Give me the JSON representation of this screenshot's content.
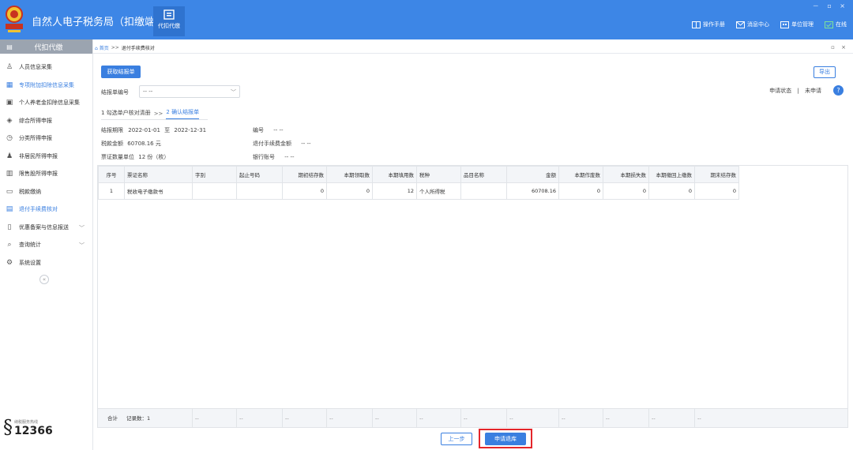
{
  "topbar": {
    "app_title": "自然人电子税务局（扣缴端）",
    "nav_box_label": "代扣代缴",
    "window_controls": "－ ▫ ×",
    "right_items": [
      {
        "label": "操作手册",
        "icon": "book-icon"
      },
      {
        "label": "消息中心",
        "icon": "message-icon"
      },
      {
        "label": "单位管理",
        "icon": "building-icon"
      },
      {
        "label": "在线",
        "icon": "online-icon"
      }
    ]
  },
  "sidebar": {
    "header": "代扣代缴",
    "items": [
      {
        "label": "人员信息采集",
        "icon": "person-icon",
        "active": false
      },
      {
        "label": "专项附加扣除信息采集",
        "icon": "grid-icon",
        "active": true
      },
      {
        "label": "个人养老金扣除信息采集",
        "icon": "document-icon",
        "active": false
      },
      {
        "label": "综合所得申报",
        "icon": "layers-icon",
        "active": false
      },
      {
        "label": "分类所得申报",
        "icon": "clock-icon",
        "active": false
      },
      {
        "label": "非居民所得申报",
        "icon": "user-icon",
        "active": false
      },
      {
        "label": "限售股所得申报",
        "icon": "bar-chart-icon",
        "active": false
      },
      {
        "label": "税款缴纳",
        "icon": "wallet-icon",
        "active": false
      },
      {
        "label": "退付手续费核对",
        "icon": "form-icon",
        "active": true
      },
      {
        "label": "优惠备案与信息报送",
        "icon": "file-icon",
        "active": false,
        "has_children": true
      },
      {
        "label": "查询统计",
        "icon": "search-icon",
        "active": false,
        "has_children": true
      },
      {
        "label": "系统设置",
        "icon": "gear-icon",
        "active": false
      }
    ],
    "hotline_caption": "纳税服务热线",
    "hotline_number": "12366"
  },
  "breadcrumb": {
    "home": "首页",
    "separator": ">>",
    "current": "退付手续费核对",
    "window_buttons": "▫ ×"
  },
  "toolbar": {
    "fetch_button": "获取结报单",
    "export_button": "导出"
  },
  "form": {
    "settlement_no_label": "结报单编号",
    "settlement_no_value": "-- --",
    "status_label": "申请状态",
    "status_separator": "|",
    "status_value": "未申请"
  },
  "steps": {
    "step1": "1 勾选单户核对清册",
    "separator": ">>",
    "step2": "2 确认结报单"
  },
  "info": {
    "period_label": "结报期限",
    "period_start": "2022-01-01",
    "period_to": "至",
    "period_end": "2022-12-31",
    "tax_amount_label": "税款金额",
    "tax_amount_value": "60708.16 元",
    "voucher_label": "票证数量单位",
    "voucher_value": "12 份（枚）",
    "number_label": "编号",
    "number_value": "-- --",
    "refund_label": "退付手续费金额",
    "refund_value": "-- --",
    "bank_label": "银行账号",
    "bank_value": "-- --"
  },
  "table": {
    "columns": [
      "序号",
      "票证名称",
      "字别",
      "起止号码",
      "期初结存数",
      "本期领取数",
      "本期填用数",
      "税种",
      "品目名称",
      "金额",
      "本期作废数",
      "本期损失数",
      "本期缴回上缴数",
      "期末结存数"
    ],
    "rows": [
      [
        "1",
        "税收电子缴款书",
        "",
        "",
        "0",
        "0",
        "12",
        "个人所得税",
        "",
        "60708.16",
        "0",
        "0",
        "0",
        "0"
      ]
    ],
    "footer_total_label": "合计",
    "footer_count_label": "记录数：1",
    "footer_placeholder": "--"
  },
  "bottom": {
    "prev_button": "上一步",
    "apply_button": "申请退库"
  },
  "colors": {
    "brand_blue": "#3d86e6",
    "accent_blue": "#3a7fe0",
    "highlight_red": "#e4262b",
    "sidebar_header": "#9ba4b0"
  }
}
